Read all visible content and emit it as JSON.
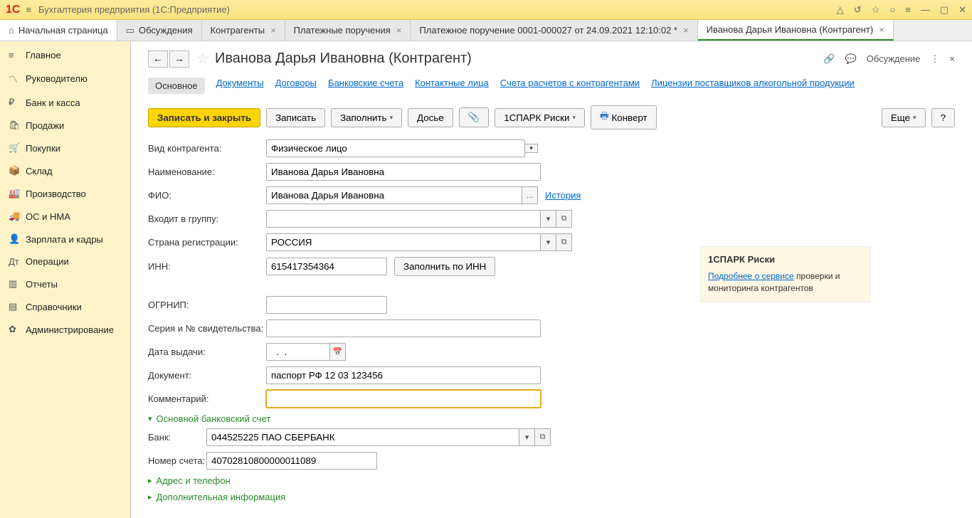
{
  "app": {
    "title": "Бухгалтерия предприятия  (1С:Предприятие)"
  },
  "tabs": {
    "home": "Начальная страница",
    "t1": "Обсуждения",
    "t2": "Контрагенты",
    "t3": "Платежные поручения",
    "t4": "Платежное поручение 0001-000027 от 24.09.2021 12:10:02 *",
    "t5": "Иванова Дарья Ивановна (Контрагент)"
  },
  "sidebar": {
    "items": [
      "Главное",
      "Руководителю",
      "Банк и касса",
      "Продажи",
      "Покупки",
      "Склад",
      "Производство",
      "ОС и НМА",
      "Зарплата и кадры",
      "Операции",
      "Отчеты",
      "Справочники",
      "Администрирование"
    ]
  },
  "page": {
    "title": "Иванова Дарья Ивановна (Контрагент)",
    "discussion": "Обсуждение"
  },
  "subtabs": [
    "Основное",
    "Документы",
    "Договоры",
    "Банковские счета",
    "Контактные лица",
    "Счета расчетов с контрагентами",
    "Лицензии поставщиков алкогольной продукции"
  ],
  "toolbar": {
    "save_close": "Записать и закрыть",
    "save": "Записать",
    "fill": "Заполнить",
    "dossier": "Досье",
    "spark": "1СПАРК Риски",
    "envelope": "Конверт",
    "more": "Еще",
    "help": "?"
  },
  "labels": {
    "type": "Вид контрагента:",
    "name": "Наименование:",
    "fio": "ФИО:",
    "group": "Входит в группу:",
    "country": "Страна регистрации:",
    "inn": "ИНН:",
    "fill_inn": "Заполнить по ИНН",
    "ogrnip": "ОГРНИП:",
    "cert": "Серия и № свидетельства:",
    "issue_date": "Дата выдачи:",
    "document": "Документ:",
    "comment": "Комментарий:",
    "section_bank": "Основной банковский счет",
    "bank": "Банк:",
    "account": "Номер счета:",
    "section_address": "Адрес и телефон",
    "section_extra": "Дополнительная информация",
    "history": "История"
  },
  "values": {
    "type": "Физическое лицо",
    "name": "Иванова Дарья Ивановна",
    "fio": "Иванова Дарья Ивановна",
    "group": "",
    "country": "РОССИЯ",
    "inn": "615417354364",
    "ogrnip": "",
    "cert": "",
    "issue_date": "  .  .",
    "document": "паспорт РФ 12 03 123456",
    "comment": "",
    "bank": "044525225 ПАО СБЕРБАНК",
    "account": "40702810800000011089"
  },
  "info": {
    "title": "1СПАРК Риски",
    "link": "Подробнее о сервисе",
    "text": " проверки и мониторинга контрагентов"
  }
}
